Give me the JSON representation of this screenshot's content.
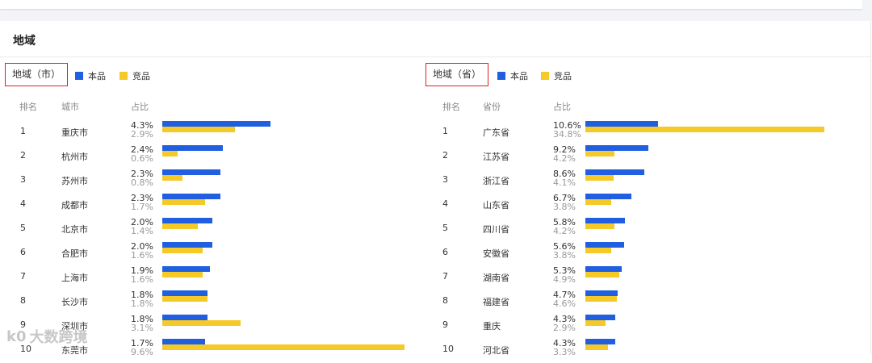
{
  "section_title": "地域",
  "colors": {
    "own": "#1f5fe0",
    "competitor": "#f5c928"
  },
  "legend": {
    "own": "本品",
    "competitor": "竞品"
  },
  "watermark": {
    "logo": "k0",
    "text": "大数跨境"
  },
  "city": {
    "label": "地域（市）",
    "col_rank": "排名",
    "col_name": "城市",
    "col_pct": "占比",
    "rows": [
      {
        "rank": "1",
        "name": "重庆市",
        "own": "4.3%",
        "comp": "2.9%"
      },
      {
        "rank": "2",
        "name": "杭州市",
        "own": "2.4%",
        "comp": "0.6%"
      },
      {
        "rank": "3",
        "name": "苏州市",
        "own": "2.3%",
        "comp": "0.8%"
      },
      {
        "rank": "4",
        "name": "成都市",
        "own": "2.3%",
        "comp": "1.7%"
      },
      {
        "rank": "5",
        "name": "北京市",
        "own": "2.0%",
        "comp": "1.4%"
      },
      {
        "rank": "6",
        "name": "合肥市",
        "own": "2.0%",
        "comp": "1.6%"
      },
      {
        "rank": "7",
        "name": "上海市",
        "own": "1.9%",
        "comp": "1.6%"
      },
      {
        "rank": "8",
        "name": "长沙市",
        "own": "1.8%",
        "comp": "1.8%"
      },
      {
        "rank": "9",
        "name": "深圳市",
        "own": "1.8%",
        "comp": "3.1%"
      },
      {
        "rank": "10",
        "name": "东莞市",
        "own": "1.7%",
        "comp": "9.6%"
      }
    ]
  },
  "province": {
    "label": "地域（省）",
    "col_rank": "排名",
    "col_name": "省份",
    "col_pct": "占比",
    "rows": [
      {
        "rank": "1",
        "name": "广东省",
        "own": "10.6%",
        "comp": "34.8%"
      },
      {
        "rank": "2",
        "name": "江苏省",
        "own": "9.2%",
        "comp": "4.2%"
      },
      {
        "rank": "3",
        "name": "浙江省",
        "own": "8.6%",
        "comp": "4.1%"
      },
      {
        "rank": "4",
        "name": "山东省",
        "own": "6.7%",
        "comp": "3.8%"
      },
      {
        "rank": "5",
        "name": "四川省",
        "own": "5.8%",
        "comp": "4.2%"
      },
      {
        "rank": "6",
        "name": "安徽省",
        "own": "5.6%",
        "comp": "3.8%"
      },
      {
        "rank": "7",
        "name": "湖南省",
        "own": "5.3%",
        "comp": "4.9%"
      },
      {
        "rank": "8",
        "name": "福建省",
        "own": "4.7%",
        "comp": "4.6%"
      },
      {
        "rank": "9",
        "name": "重庆",
        "own": "4.3%",
        "comp": "2.9%"
      },
      {
        "rank": "10",
        "name": "河北省",
        "own": "4.3%",
        "comp": "3.3%"
      }
    ]
  }
}
